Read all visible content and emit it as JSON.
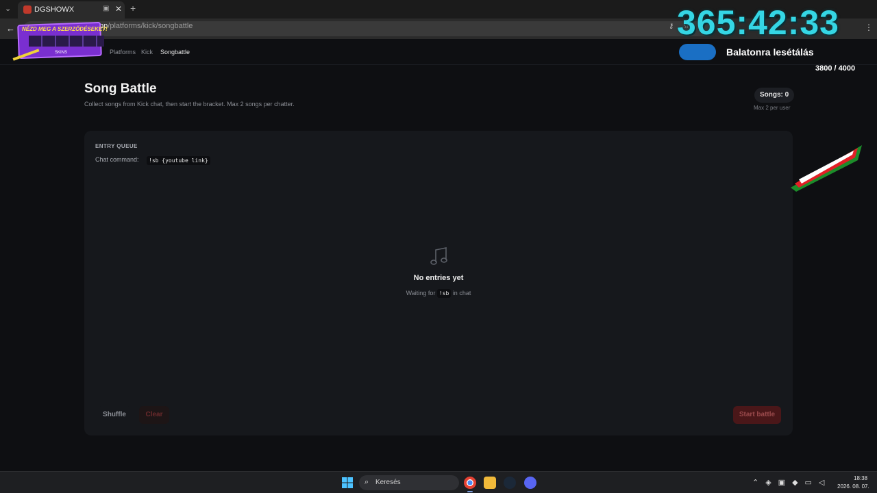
{
  "browser": {
    "tab_title": "DGSHOWX",
    "url_prefix": "ercel.app",
    "url_path": "/platforms/kick/songbattle"
  },
  "breadcrumb": {
    "items": [
      "Platforms",
      "Kick",
      "Songbattle"
    ]
  },
  "header": {
    "title": "Song Battle",
    "subtitle": "Collect songs from Kick chat, then start the bracket. Max 2 songs per chatter.",
    "songs_label": "Songs: 0",
    "max_note": "Max 2 per user"
  },
  "queue": {
    "heading": "ENTRY QUEUE",
    "command_label": "Chat command:",
    "command_code": "!sb {youtube link}",
    "empty_title": "No entries yet",
    "empty_waiting": "Waiting for",
    "empty_code": "!sb",
    "empty_suffix": "in chat"
  },
  "actions": {
    "shuffle": "Shuffle",
    "clear": "Clear",
    "start": "Start battle"
  },
  "taskbar": {
    "search_placeholder": "Keresés",
    "time": "18:38",
    "date": "2026. 08. 07."
  },
  "overlay": {
    "timer": "365:42:33",
    "goal_title": "Balatonra lesétálás",
    "goal_count": "3800 / 4000",
    "goal_progress": 0.95,
    "sponsor_headline": "NÉZD MEG A SZERZŐDÉSEKET!",
    "sponsor_brand": "SKINS",
    "timer_color": "#35d6e4"
  },
  "colors": {
    "background": "#0e0f12",
    "card": "#16181c",
    "danger": "#4a1719",
    "goal_bar": "#1a6fc4"
  }
}
